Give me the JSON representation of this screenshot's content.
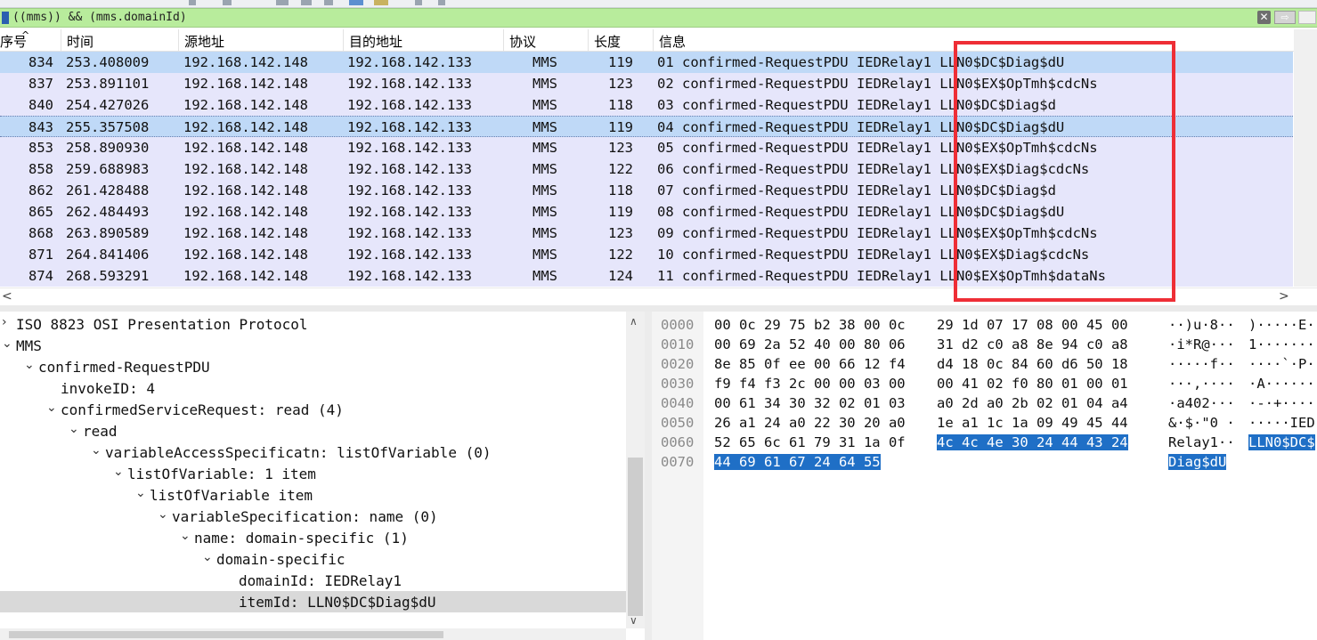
{
  "filter": {
    "expression": "((mms)) && (mms.domainId)",
    "clear_icon": "✕",
    "apply_icon": "⇨"
  },
  "packet_list": {
    "columns": [
      "序号",
      "时间",
      "源地址",
      "目的地址",
      "协议",
      "长度",
      "信息"
    ],
    "rows": [
      {
        "no": "834",
        "time": "253.408009",
        "src": "192.168.142.148",
        "dst": "192.168.142.133",
        "proto": "MMS",
        "len": "119",
        "info": "01 confirmed-RequestPDU IEDRelay1 LLN0$DC$Diag$dU"
      },
      {
        "no": "837",
        "time": "253.891101",
        "src": "192.168.142.148",
        "dst": "192.168.142.133",
        "proto": "MMS",
        "len": "123",
        "info": "02 confirmed-RequestPDU IEDRelay1 LLN0$EX$OpTmh$cdcNs"
      },
      {
        "no": "840",
        "time": "254.427026",
        "src": "192.168.142.148",
        "dst": "192.168.142.133",
        "proto": "MMS",
        "len": "118",
        "info": "03 confirmed-RequestPDU IEDRelay1 LLN0$DC$Diag$d"
      },
      {
        "no": "843",
        "time": "255.357508",
        "src": "192.168.142.148",
        "dst": "192.168.142.133",
        "proto": "MMS",
        "len": "119",
        "info": "04 confirmed-RequestPDU IEDRelay1 LLN0$DC$Diag$dU"
      },
      {
        "no": "853",
        "time": "258.890930",
        "src": "192.168.142.148",
        "dst": "192.168.142.133",
        "proto": "MMS",
        "len": "123",
        "info": "05 confirmed-RequestPDU IEDRelay1 LLN0$EX$OpTmh$cdcNs"
      },
      {
        "no": "858",
        "time": "259.688983",
        "src": "192.168.142.148",
        "dst": "192.168.142.133",
        "proto": "MMS",
        "len": "122",
        "info": "06 confirmed-RequestPDU IEDRelay1 LLN0$EX$Diag$cdcNs"
      },
      {
        "no": "862",
        "time": "261.428488",
        "src": "192.168.142.148",
        "dst": "192.168.142.133",
        "proto": "MMS",
        "len": "118",
        "info": "07 confirmed-RequestPDU IEDRelay1 LLN0$DC$Diag$d"
      },
      {
        "no": "865",
        "time": "262.484493",
        "src": "192.168.142.148",
        "dst": "192.168.142.133",
        "proto": "MMS",
        "len": "119",
        "info": "08 confirmed-RequestPDU IEDRelay1 LLN0$DC$Diag$dU"
      },
      {
        "no": "868",
        "time": "263.890589",
        "src": "192.168.142.148",
        "dst": "192.168.142.133",
        "proto": "MMS",
        "len": "123",
        "info": "09 confirmed-RequestPDU IEDRelay1 LLN0$EX$OpTmh$cdcNs"
      },
      {
        "no": "871",
        "time": "264.841406",
        "src": "192.168.142.148",
        "dst": "192.168.142.133",
        "proto": "MMS",
        "len": "122",
        "info": "10 confirmed-RequestPDU IEDRelay1 LLN0$EX$Diag$cdcNs"
      },
      {
        "no": "874",
        "time": "268.593291",
        "src": "192.168.142.148",
        "dst": "192.168.142.133",
        "proto": "MMS",
        "len": "124",
        "info": "11 confirmed-RequestPDU IEDRelay1 LLN0$EX$OpTmh$dataNs"
      }
    ],
    "selected_row": "843",
    "highlight_color": "#ee2e36"
  },
  "details_tree": [
    {
      "arrow": "›",
      "label": "ISO 8823 OSI Presentation Protocol"
    },
    {
      "arrow": "⌄",
      "label": "MMS"
    },
    {
      "arrow": "⌄",
      "label": "confirmed-RequestPDU"
    },
    {
      "arrow": "",
      "label": "invokeID: 4"
    },
    {
      "arrow": "⌄",
      "label": "confirmedServiceRequest: read (4)"
    },
    {
      "arrow": "⌄",
      "label": "read"
    },
    {
      "arrow": "⌄",
      "label": "variableAccessSpecificatn: listOfVariable (0)"
    },
    {
      "arrow": "⌄",
      "label": "listOfVariable: 1 item"
    },
    {
      "arrow": "⌄",
      "label": "listOfVariable item"
    },
    {
      "arrow": "⌄",
      "label": "variableSpecification: name (0)"
    },
    {
      "arrow": "⌄",
      "label": "name: domain-specific (1)"
    },
    {
      "arrow": "⌄",
      "label": "domain-specific"
    },
    {
      "arrow": "",
      "label": "domainId: IEDRelay1"
    },
    {
      "arrow": "",
      "label": "itemId: LLN0$DC$Diag$dU"
    }
  ],
  "bytes": [
    {
      "offset": "0000",
      "hex": [
        {
          "t": "00 0c 29 75 b2 38 00 0c",
          "h": false
        },
        {
          "t": "29 1d 07 17 08 00 45 00",
          "h": false
        }
      ],
      "ascii": [
        {
          "t": "··)u·8··",
          "h": false
        },
        {
          "t": ")·····E·",
          "h": false
        }
      ]
    },
    {
      "offset": "0010",
      "hex": [
        {
          "t": "00 69 2a 52 40 00 80 06",
          "h": false
        },
        {
          "t": "31 d2 c0 a8 8e 94 c0 a8",
          "h": false
        }
      ],
      "ascii": [
        {
          "t": "·i*R@···",
          "h": false
        },
        {
          "t": "1·······",
          "h": false
        }
      ]
    },
    {
      "offset": "0020",
      "hex": [
        {
          "t": "8e 85 0f ee 00 66 12 f4",
          "h": false
        },
        {
          "t": "d4 18 0c 84 60 d6 50 18",
          "h": false
        }
      ],
      "ascii": [
        {
          "t": "·····f··",
          "h": false
        },
        {
          "t": "····`·P·",
          "h": false
        }
      ]
    },
    {
      "offset": "0030",
      "hex": [
        {
          "t": "f9 f4 f3 2c 00 00 03 00",
          "h": false
        },
        {
          "t": "00 41 02 f0 80 01 00 01",
          "h": false
        }
      ],
      "ascii": [
        {
          "t": "···,····",
          "h": false
        },
        {
          "t": "·A······",
          "h": false
        }
      ]
    },
    {
      "offset": "0040",
      "hex": [
        {
          "t": "00 61 34 30 32 02 01 03",
          "h": false
        },
        {
          "t": "a0 2d a0 2b 02 01 04 a4",
          "h": false
        }
      ],
      "ascii": [
        {
          "t": "·a402···",
          "h": false
        },
        {
          "t": "·-·+····",
          "h": false
        }
      ]
    },
    {
      "offset": "0050",
      "hex": [
        {
          "t": "26 a1 24 a0 22 30 20 a0",
          "h": false
        },
        {
          "t": "1e a1 1c 1a 09 49 45 44",
          "h": false
        }
      ],
      "ascii": [
        {
          "t": "&·$·\"0 ·",
          "h": false
        },
        {
          "t": "·····IED",
          "h": false
        }
      ]
    },
    {
      "offset": "0060",
      "hex": [
        {
          "t": "52 65 6c 61 79 31 1a 0f",
          "h": false
        },
        {
          "t": "4c 4c 4e 30 24 44 43 24",
          "h": true
        }
      ],
      "ascii": [
        {
          "t": "Relay1··",
          "h": false
        },
        {
          "t": "LLN0$DC$",
          "h": true
        }
      ]
    },
    {
      "offset": "0070",
      "hex": [
        {
          "t": "44 69 61 67 24 64 55",
          "h": true
        },
        {
          "t": "",
          "h": false
        }
      ],
      "ascii": [
        {
          "t": "Diag$dU",
          "h": true
        },
        {
          "t": "",
          "h": false
        }
      ]
    }
  ],
  "scroll": {
    "left_arrow": "<",
    "right_arrow": ">",
    "up_arrow": "∧",
    "down_arrow": "∨"
  }
}
